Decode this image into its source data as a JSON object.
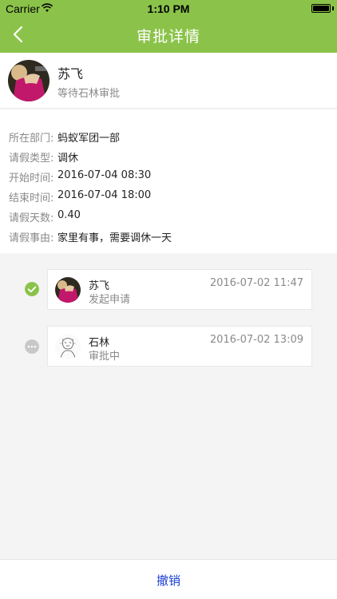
{
  "status_bar": {
    "carrier": "Carrier",
    "time": "1:10 PM"
  },
  "nav": {
    "title": "审批详情",
    "back_icon": "chevron-left-icon"
  },
  "profile": {
    "name": "苏飞",
    "status": "等待石林审批"
  },
  "details": [
    {
      "label": "所在部门:",
      "value": "蚂蚁军团一部"
    },
    {
      "label": "请假类型:",
      "value": "调休"
    },
    {
      "label": "开始时间:",
      "value": "2016-07-04 08:30"
    },
    {
      "label": "结束时间:",
      "value": "2016-07-04 18:00"
    },
    {
      "label": "请假天数:",
      "value": "0.40"
    },
    {
      "label": "请假事由:",
      "value": "家里有事，需要调休一天"
    }
  ],
  "timeline": [
    {
      "name": "苏飞",
      "action": "发起申请",
      "time": "2016-07-02 11:47",
      "state_icon": "check-circle-icon",
      "state_color": "#8bc34a"
    },
    {
      "name": "石林",
      "action": "审批中",
      "time": "2016-07-02 13:09",
      "state_icon": "more-circle-icon",
      "state_color": "#c8c8c8"
    }
  ],
  "bottom": {
    "revoke_label": "撤销"
  },
  "colors": {
    "accent": "#8bc34a",
    "link": "#1a3fd1"
  }
}
